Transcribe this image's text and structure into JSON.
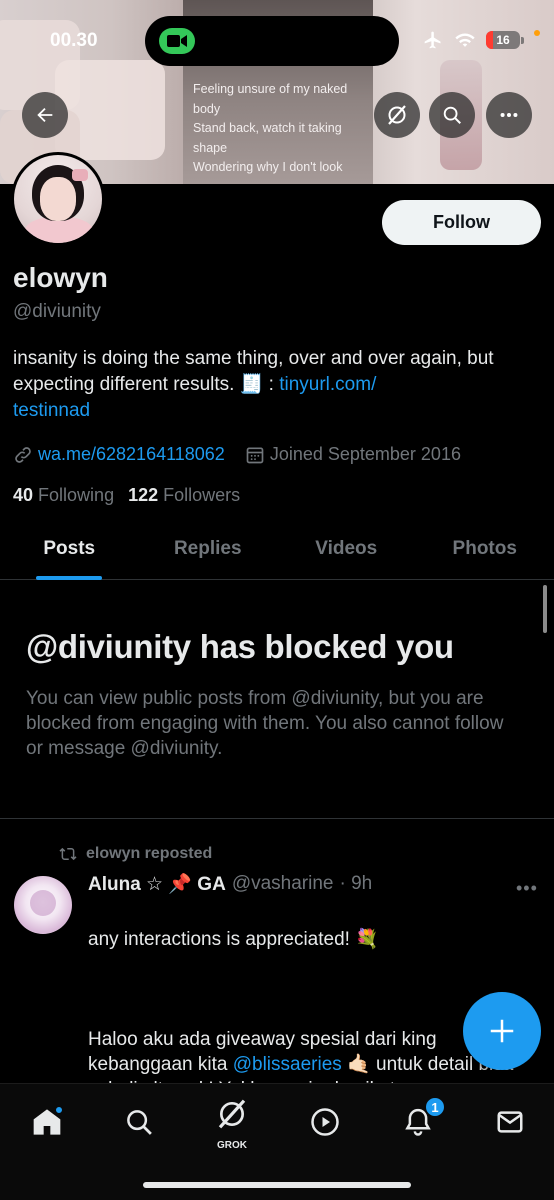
{
  "status_bar": {
    "time": "00.30",
    "battery": "16",
    "battery_level": 0.16,
    "icons": [
      "facetime-camera-icon",
      "airplane-icon",
      "wifi-icon",
      "battery-icon"
    ]
  },
  "banner": {
    "lyrics": [
      "Feeling unsure of my naked",
      "body",
      "Stand back, watch it taking",
      "shape",
      "Wondering why I don't look"
    ]
  },
  "profile": {
    "display_name": "elowyn",
    "handle": "@diviunity",
    "follow_label": "Follow",
    "bio_text": "insanity is doing the same thing, over and over again, but expecting different results. 🧾 : ",
    "bio_link_1": "tinyurl.com/",
    "bio_link_2": "testinnad",
    "website": "wa.me/6282164118062",
    "joined": "Joined September 2016",
    "following_count": "40",
    "following_label": "Following",
    "followers_count": "122",
    "followers_label": "Followers"
  },
  "tabs": [
    {
      "label": "Posts",
      "active": true
    },
    {
      "label": "Replies",
      "active": false
    },
    {
      "label": "Videos",
      "active": false
    },
    {
      "label": "Photos",
      "active": false
    }
  ],
  "blocked": {
    "title": "@diviunity has blocked you",
    "description": "You can view public posts from @diviunity, but you are blocked from engaging with them. You also cannot follow or message @diviunity."
  },
  "post": {
    "repost_label": "elowyn reposted",
    "author_name": "Aluna ☆ 📌 GA",
    "author_handle": "@vasharine",
    "time": "· 9h",
    "line1": "any interactions is appreciated! 💐",
    "line2a": "Haloo aku ada giveaway spesial dari king kebanggaan kita ",
    "mention": "@blissaeries",
    "line2b": " 🤙🏻 untuk detail bisa cek di alt yaak! Yukk ramein dan ikut",
    "line3": "❤️",
    "more": "•••"
  },
  "bottom_nav": {
    "grok_label": "GROK",
    "notifications_count": "1"
  },
  "colors": {
    "accent": "#1d9bf0",
    "background": "#000000",
    "text_primary": "#e7e9ea",
    "text_secondary": "#71767b"
  }
}
